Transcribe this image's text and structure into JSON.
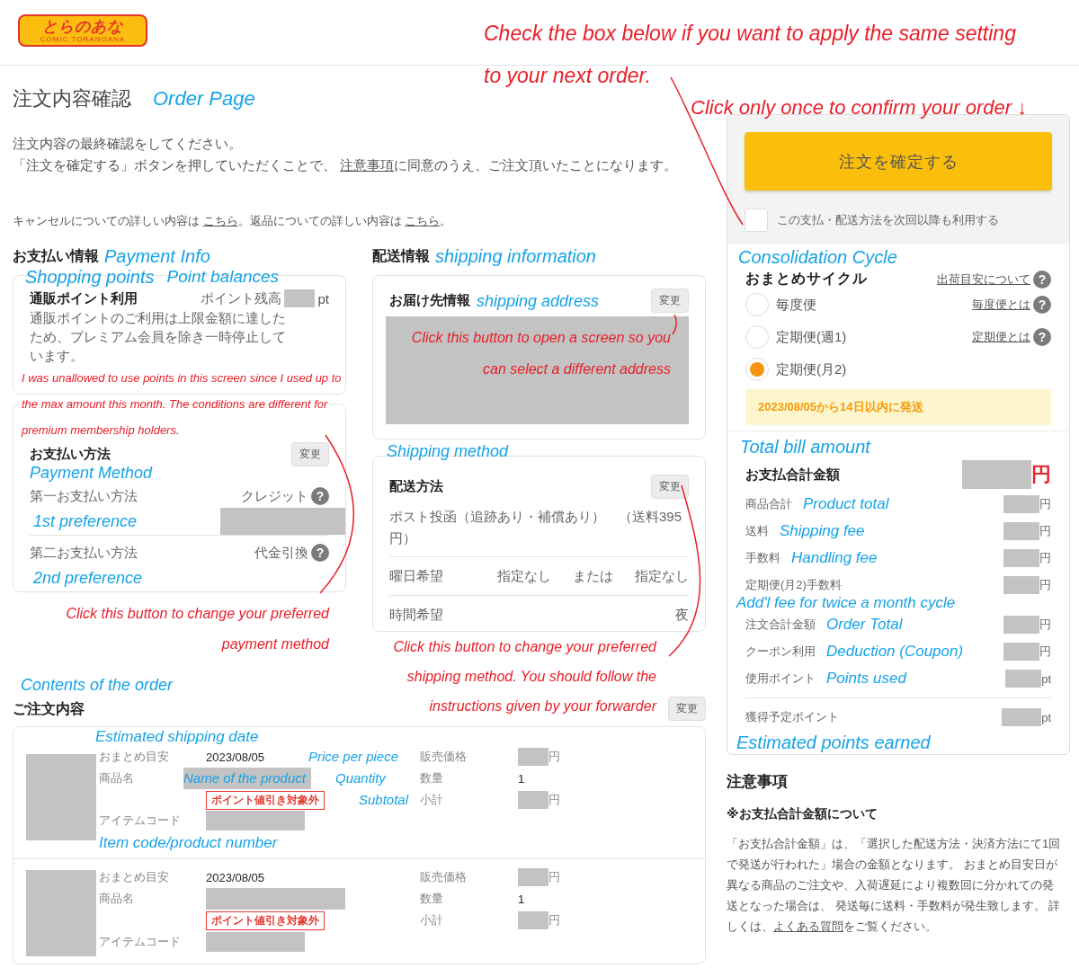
{
  "header": {
    "logo_text": "とらのあな",
    "logo_subtext": "COMIC TORANOANA"
  },
  "page": {
    "title": "注文内容確認",
    "intro": [
      {
        "kind": "text",
        "text": "注文内容の最終確認をしてください。"
      },
      {
        "kind": "break"
      },
      {
        "kind": "text",
        "text": "「注文を確定する」ボタンを押していただくことで、 "
      },
      {
        "kind": "link",
        "text": "注意事項"
      },
      {
        "kind": "text",
        "text": "に同意のうえ、ご注文頂いたことになります。"
      }
    ],
    "cancel_note": [
      {
        "kind": "text",
        "text": "キャンセルについての詳しい内容は "
      },
      {
        "kind": "link",
        "text": "こちら"
      },
      {
        "kind": "text",
        "text": "。返品についての詳しい内容は "
      },
      {
        "kind": "link",
        "text": "こちら"
      },
      {
        "kind": "text",
        "text": "。"
      }
    ]
  },
  "payment": {
    "heading": "お支払い情報",
    "points": {
      "title": "通販ポイント利用",
      "balance_label": "ポイント残高",
      "balance_unit": "pt",
      "note": "通販ポイントのご利用は上限金額に達したため、プレミアム会員を除き一時停止しています。"
    },
    "method": {
      "title": "お支払い方法",
      "change_button": "変更",
      "methods": [
        {
          "label": "第一お支払い方法",
          "value": "クレジット",
          "help": "?",
          "redacted": true
        },
        {
          "label": "第二お支払い方法",
          "value": "代金引換",
          "help": "?",
          "redacted": false
        }
      ]
    }
  },
  "shipping": {
    "heading": "配送情報",
    "address": {
      "title": "お届け先情報",
      "change_button": "変更"
    },
    "method": {
      "title": "配送方法",
      "change_button": "変更",
      "value": "ポスト投函（追跡あり・補償あり）　（送料395円）",
      "rows": [
        {
          "label": "曜日希望",
          "values": [
            "指定なし",
            "または",
            "指定なし"
          ]
        },
        {
          "label": "時間希望",
          "values": [
            "夜"
          ]
        }
      ]
    }
  },
  "order": {
    "heading": "ご注文内容",
    "change_button": "変更",
    "items": [
      {
        "date_label": "おまとめ目安",
        "date": "2023/08/05",
        "name_label": "商品名",
        "tag": "ポイント値引き対象外",
        "code_label": "アイテムコード",
        "price_label": "販売価格",
        "price_unit": "円",
        "qty_label": "数量",
        "qty": "1",
        "subtotal_label": "小計",
        "subtotal_unit": "円"
      },
      {
        "date_label": "おまとめ目安",
        "date": "2023/08/05",
        "name_label": "商品名",
        "tag": "ポイント値引き対象外",
        "code_label": "アイテムコード",
        "price_label": "販売価格",
        "price_unit": "円",
        "qty_label": "数量",
        "qty": "1",
        "subtotal_label": "小計",
        "subtotal_unit": "円"
      }
    ]
  },
  "sidebar": {
    "confirm_button": "注文を確定する",
    "reuse_checkbox": {
      "label": "この支払・配送方法を次回以降も利用する",
      "checked": false
    },
    "cycle": {
      "title": "おまとめサイクル",
      "help_link": "出荷目安について",
      "help": "?",
      "options": [
        {
          "label": "毎度便",
          "link": "毎度便とは",
          "help": "?",
          "selected": false
        },
        {
          "label": "定期便(週1)",
          "link": "定期便とは",
          "help": "?",
          "selected": false
        },
        {
          "label": "定期便(月2)",
          "selected": true
        }
      ],
      "notice": "2023/08/05から14日以内に発送"
    },
    "totals": {
      "title": "お支払合計金額",
      "unit": "円",
      "rows": [
        {
          "label": "商品合計",
          "unit": "円"
        },
        {
          "label": "送料",
          "unit": "円"
        },
        {
          "label": "手数料",
          "unit": "円"
        },
        {
          "label": "定期便(月2)手数料",
          "unit": "円"
        },
        {
          "label": "注文合計金額",
          "unit": "円"
        },
        {
          "label": "クーポン利用",
          "unit": "円"
        },
        {
          "label": "使用ポイント",
          "unit": "pt"
        }
      ],
      "earned": {
        "label": "獲得予定ポイント",
        "unit": "pt"
      }
    }
  },
  "notes": {
    "title": "注意事項",
    "subtitle": "※お支払合計金額について",
    "body": [
      {
        "kind": "text",
        "text": "「お支払合計金額」は、「選択した配送方法・決済方法にて1回で発送が行われた」場合の金額となります。 おまとめ目安日が異なる商品のご注文や、入荷遅延により複数回に分かれての発送となった場合は、 発送毎に送料・手数料が発生致します。 詳しくは、"
      },
      {
        "kind": "link",
        "text": "よくある質問"
      },
      {
        "kind": "text",
        "text": "をご覧ください。"
      }
    ]
  },
  "annotations": [
    {
      "text": "Check the box below if you want to apply the same setting to your next order.",
      "color": "#e8202a"
    },
    {
      "text": "Click only once to confirm your order ↓",
      "color": "#e8202a"
    },
    {
      "text": "Click this button to open a screen so you can select a different address",
      "color": "#e8202a"
    },
    {
      "text": "I was unallowed to use points in this screen since I used up to the max amount this month. The conditions are different for premium membership holders.",
      "color": "#e8202a"
    },
    {
      "text": "Click this button to change your preferred payment method",
      "color": "#e8202a"
    },
    {
      "text": "Click this button to change your preferred shipping method.  You should follow the instructions given by your forwarder",
      "color": "#e8202a"
    },
    {
      "text": "Order Page",
      "color": "#16a3e6"
    },
    {
      "text": "Payment Info",
      "color": "#16a3e6"
    },
    {
      "text": "shipping information",
      "color": "#16a3e6"
    },
    {
      "text": "Shopping points",
      "color": "#16a3e6"
    },
    {
      "text": "Point balances",
      "color": "#16a3e6"
    },
    {
      "text": "shipping address",
      "color": "#16a3e6"
    },
    {
      "text": "Payment Method",
      "color": "#16a3e6"
    },
    {
      "text": "1st preference",
      "color": "#16a3e6"
    },
    {
      "text": "2nd preference",
      "color": "#16a3e6"
    },
    {
      "text": "Shipping method",
      "color": "#16a3e6"
    },
    {
      "text": "Consolidation Cycle",
      "color": "#16a3e6"
    },
    {
      "text": "Total bill amount",
      "color": "#16a3e6"
    },
    {
      "text": "Product total",
      "color": "#16a3e6"
    },
    {
      "text": "Shipping fee",
      "color": "#16a3e6"
    },
    {
      "text": "Handling fee",
      "color": "#16a3e6"
    },
    {
      "text": "Add'l fee for twice a month cycle",
      "color": "#16a3e6"
    },
    {
      "text": "Order Total",
      "color": "#16a3e6"
    },
    {
      "text": "Deduction (Coupon)",
      "color": "#16a3e6"
    },
    {
      "text": "Points used",
      "color": "#16a3e6"
    },
    {
      "text": "Estimated points earned",
      "color": "#16a3e6"
    },
    {
      "text": "Contents of the order",
      "color": "#16a3e6"
    },
    {
      "text": "Estimated shipping date",
      "color": "#16a3e6"
    },
    {
      "text": "Price per piece",
      "color": "#16a3e6"
    },
    {
      "text": "Name of the product",
      "color": "#16a3e6"
    },
    {
      "text": "Quantity",
      "color": "#16a3e6"
    },
    {
      "text": "Subtotal",
      "color": "#16a3e6"
    },
    {
      "text": "Item code/product number",
      "color": "#16a3e6"
    }
  ]
}
